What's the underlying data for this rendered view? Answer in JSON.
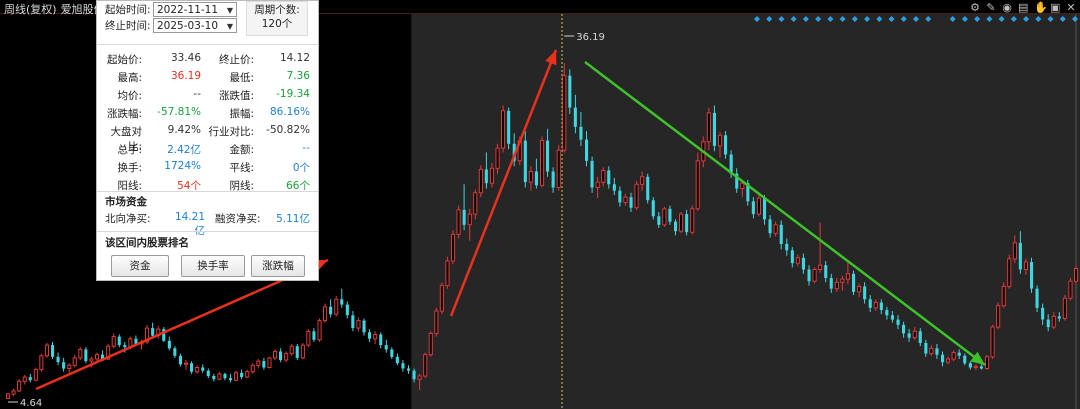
{
  "header": {
    "title_parts": [
      "周线(复权)",
      "爱旭股份"
    ],
    "toolbar_icons": [
      "gear-icon",
      "pen-icon",
      "eye-icon",
      "print-icon",
      "hand-icon",
      "lock-icon",
      "close-icon"
    ]
  },
  "panel": {
    "start_label": "起始时间:",
    "start_date": "2022-11-11",
    "end_label": "终止时间:",
    "end_date": "2025-03-10",
    "count_label": "周期个数:",
    "count_value": "120个",
    "stats": [
      {
        "l1": "起始价:",
        "v1": "33.46",
        "c1": "dark",
        "l2": "终止价:",
        "v2": "14.12",
        "c2": "dark"
      },
      {
        "l1": "最高:",
        "v1": "36.19",
        "c1": "red",
        "l2": "最低:",
        "v2": "7.36",
        "c2": "green"
      },
      {
        "l1": "均价:",
        "v1": "--",
        "c1": "dark",
        "l2": "涨跌值:",
        "v2": "-19.34",
        "c2": "green"
      },
      {
        "l1": "涨跌幅:",
        "v1": "-57.81%",
        "c1": "green",
        "l2": "振幅:",
        "v2": "86.16%",
        "c2": "blue"
      },
      {
        "l1": "大盘对比:",
        "v1": "9.42%",
        "c1": "dark",
        "l2": "行业对比:",
        "v2": "-50.82%",
        "c2": "dark"
      },
      {
        "l1": "总手:",
        "v1": "2.42亿",
        "c1": "blue",
        "l2": "金额:",
        "v2": "--",
        "c2": "blue"
      },
      {
        "l1": "换手:",
        "v1": "1724%",
        "c1": "blue",
        "l2": "平线:",
        "v2": "0个",
        "c2": "blue"
      },
      {
        "l1": "阳线:",
        "v1": "54个",
        "c1": "red",
        "l2": "阴线:",
        "v2": "66个",
        "c2": "green"
      }
    ],
    "fund_title": "市场资金",
    "north_label": "北向净买:",
    "north_value": "14.21亿",
    "margin_label": "融资净买:",
    "margin_value": "5.11亿",
    "rank_title": "该区间内股票排名",
    "buttons": [
      "资金",
      "换手率",
      "涨跌幅"
    ]
  },
  "colors": {
    "up": "#e03a3a",
    "down": "#3ed6e0",
    "red_arrow": "#e8321e",
    "green_arrow": "#3ec22a",
    "selection_bg": "#262626",
    "marker": "#2f9de0"
  },
  "chart_data": {
    "type": "candlestick",
    "periodicity": "weekly",
    "annotations": {
      "high_label": "36.19",
      "low_label": "4.64"
    },
    "high": 36.19,
    "low": 4.64,
    "selection": {
      "start": "2022-11-11",
      "end": "2025-03-10",
      "periods": 120
    },
    "ohlc": [
      [
        4.7,
        5.2,
        4.64,
        5.1
      ],
      [
        5.1,
        5.6,
        4.9,
        5.4
      ],
      [
        5.4,
        6.5,
        5.3,
        6.3
      ],
      [
        6.3,
        6.9,
        6.0,
        6.7
      ],
      [
        6.7,
        7.0,
        6.2,
        6.4
      ],
      [
        6.4,
        7.6,
        6.3,
        7.4
      ],
      [
        7.4,
        8.9,
        7.2,
        8.7
      ],
      [
        8.7,
        9.9,
        8.5,
        9.7
      ],
      [
        9.7,
        10.0,
        8.4,
        8.6
      ],
      [
        8.6,
        9.0,
        7.8,
        8.1
      ],
      [
        8.1,
        8.5,
        7.2,
        7.5
      ],
      [
        7.5,
        8.0,
        7.1,
        7.8
      ],
      [
        7.8,
        8.8,
        7.6,
        8.5
      ],
      [
        8.5,
        9.5,
        8.3,
        9.3
      ],
      [
        9.3,
        9.5,
        8.0,
        8.2
      ],
      [
        8.2,
        8.6,
        7.6,
        8.4
      ],
      [
        8.4,
        9.0,
        8.1,
        8.8
      ],
      [
        8.8,
        9.2,
        8.2,
        8.4
      ],
      [
        8.4,
        9.8,
        8.3,
        9.6
      ],
      [
        9.6,
        10.8,
        9.4,
        10.5
      ],
      [
        10.5,
        10.7,
        9.5,
        9.7
      ],
      [
        9.7,
        10.0,
        9.0,
        9.5
      ],
      [
        9.5,
        10.5,
        9.3,
        10.3
      ],
      [
        10.3,
        10.6,
        9.6,
        9.8
      ],
      [
        9.8,
        10.2,
        9.3,
        10.0
      ],
      [
        10.0,
        11.6,
        9.8,
        11.3
      ],
      [
        11.3,
        11.8,
        10.4,
        10.6
      ],
      [
        10.6,
        11.5,
        10.3,
        11.2
      ],
      [
        11.2,
        11.4,
        10.0,
        10.1
      ],
      [
        10.1,
        10.5,
        9.2,
        9.4
      ],
      [
        9.4,
        9.6,
        8.5,
        8.7
      ],
      [
        8.7,
        8.9,
        7.7,
        7.9
      ],
      [
        7.9,
        8.3,
        7.4,
        8.0
      ],
      [
        8.0,
        8.2,
        7.0,
        7.2
      ],
      [
        7.2,
        7.8,
        7.0,
        7.6
      ],
      [
        7.6,
        7.9,
        7.1,
        7.3
      ],
      [
        7.3,
        7.5,
        6.6,
        6.8
      ],
      [
        6.8,
        7.0,
        6.3,
        6.5
      ],
      [
        6.5,
        7.2,
        6.4,
        7.0
      ],
      [
        7.0,
        7.1,
        6.4,
        6.6
      ],
      [
        6.6,
        7.0,
        6.2,
        6.4
      ],
      [
        6.4,
        7.3,
        6.3,
        7.1
      ],
      [
        7.1,
        7.4,
        6.5,
        6.7
      ],
      [
        6.7,
        7.4,
        6.6,
        7.2
      ],
      [
        7.2,
        8.0,
        7.0,
        7.8
      ],
      [
        7.8,
        8.4,
        7.5,
        8.2
      ],
      [
        8.2,
        8.5,
        7.4,
        7.6
      ],
      [
        7.6,
        8.6,
        7.5,
        8.5
      ],
      [
        8.5,
        9.3,
        8.3,
        9.1
      ],
      [
        9.1,
        9.4,
        8.1,
        8.3
      ],
      [
        8.3,
        9.1,
        8.1,
        8.9
      ],
      [
        8.9,
        9.8,
        8.7,
        9.6
      ],
      [
        9.6,
        9.8,
        8.3,
        8.5
      ],
      [
        8.5,
        9.9,
        8.4,
        9.7
      ],
      [
        9.7,
        11.2,
        9.5,
        11.0
      ],
      [
        11.0,
        11.3,
        10.0,
        10.2
      ],
      [
        10.2,
        12.2,
        10.0,
        12.0
      ],
      [
        12.0,
        13.6,
        11.8,
        13.3
      ],
      [
        13.3,
        14.0,
        12.3,
        12.6
      ],
      [
        12.6,
        14.3,
        12.4,
        14.0
      ],
      [
        14.0,
        15.0,
        13.2,
        13.5
      ],
      [
        13.5,
        13.8,
        12.2,
        12.5
      ],
      [
        12.5,
        12.9,
        11.0,
        11.3
      ],
      [
        11.3,
        12.3,
        11.0,
        12.0
      ],
      [
        12.0,
        12.2,
        10.6,
        10.9
      ],
      [
        10.9,
        11.2,
        10.0,
        10.3
      ],
      [
        10.3,
        11.0,
        9.8,
        10.7
      ],
      [
        10.7,
        10.9,
        9.4,
        9.7
      ],
      [
        9.7,
        10.2,
        9.0,
        9.3
      ],
      [
        9.3,
        9.5,
        8.4,
        8.6
      ],
      [
        8.6,
        8.9,
        7.8,
        8.0
      ],
      [
        8.0,
        8.3,
        7.2,
        7.5
      ],
      [
        7.5,
        7.8,
        7.0,
        7.3
      ],
      [
        7.3,
        7.5,
        6.2,
        6.5
      ],
      [
        6.5,
        7.0,
        5.5,
        6.8
      ],
      [
        6.8,
        9.0,
        6.6,
        8.8
      ],
      [
        8.8,
        11.0,
        8.6,
        10.8
      ],
      [
        10.8,
        13.2,
        10.5,
        12.9
      ],
      [
        12.9,
        15.6,
        12.6,
        15.3
      ],
      [
        15.3,
        18.0,
        15.0,
        17.6
      ],
      [
        17.6,
        20.5,
        17.3,
        20.1
      ],
      [
        20.1,
        22.8,
        19.7,
        22.4
      ],
      [
        22.4,
        24.8,
        20.5,
        21.0
      ],
      [
        21.0,
        22.5,
        19.5,
        22.0
      ],
      [
        22.0,
        24.3,
        21.5,
        24.0
      ],
      [
        24.0,
        26.6,
        23.6,
        26.2
      ],
      [
        26.2,
        27.8,
        24.4,
        24.9
      ],
      [
        24.9,
        26.8,
        24.5,
        26.3
      ],
      [
        26.3,
        28.6,
        25.8,
        28.2
      ],
      [
        28.2,
        32.2,
        27.8,
        31.7
      ],
      [
        31.7,
        32.0,
        28.1,
        28.6
      ],
      [
        28.6,
        29.6,
        26.5,
        27.0
      ],
      [
        27.0,
        29.3,
        26.6,
        28.9
      ],
      [
        28.9,
        29.8,
        24.5,
        25.0
      ],
      [
        25.0,
        26.5,
        24.2,
        26.0
      ],
      [
        26.0,
        27.2,
        24.4,
        24.7
      ],
      [
        24.7,
        29.3,
        24.5,
        28.9
      ],
      [
        28.9,
        30.0,
        25.5,
        26.0
      ],
      [
        26.0,
        26.4,
        24.0,
        24.5
      ],
      [
        24.5,
        28.5,
        24.2,
        28.0
      ],
      [
        28.0,
        36.19,
        27.8,
        35.0
      ],
      [
        35.0,
        35.6,
        31.4,
        32.0
      ],
      [
        32.0,
        33.2,
        29.6,
        30.2
      ],
      [
        30.2,
        31.6,
        28.4,
        29.0
      ],
      [
        29.0,
        29.8,
        26.5,
        27.0
      ],
      [
        27.0,
        27.4,
        24.0,
        24.5
      ],
      [
        24.5,
        25.5,
        23.5,
        25.0
      ],
      [
        25.0,
        26.4,
        24.6,
        26.1
      ],
      [
        26.1,
        26.5,
        24.4,
        24.8
      ],
      [
        24.8,
        25.4,
        23.8,
        24.2
      ],
      [
        24.2,
        24.6,
        22.7,
        23.1
      ],
      [
        23.1,
        23.9,
        22.8,
        23.6
      ],
      [
        23.6,
        24.0,
        22.2,
        22.6
      ],
      [
        22.6,
        25.1,
        22.4,
        24.8
      ],
      [
        24.8,
        26.0,
        24.2,
        25.5
      ],
      [
        25.5,
        25.8,
        23.0,
        23.3
      ],
      [
        23.3,
        23.6,
        21.5,
        21.8
      ],
      [
        21.8,
        22.2,
        20.7,
        21.0
      ],
      [
        21.0,
        22.7,
        20.8,
        22.5
      ],
      [
        22.5,
        22.8,
        21.0,
        21.3
      ],
      [
        21.3,
        21.5,
        20.0,
        20.4
      ],
      [
        20.4,
        22.2,
        20.2,
        22.0
      ],
      [
        22.0,
        22.4,
        20.0,
        20.3
      ],
      [
        20.3,
        22.8,
        20.1,
        22.5
      ],
      [
        22.5,
        27.8,
        22.3,
        27.0
      ],
      [
        27.0,
        29.3,
        26.4,
        28.8
      ],
      [
        28.8,
        32.0,
        28.0,
        31.5
      ],
      [
        31.5,
        32.2,
        27.9,
        28.4
      ],
      [
        28.4,
        29.7,
        27.3,
        29.4
      ],
      [
        29.4,
        29.8,
        27.2,
        27.6
      ],
      [
        27.6,
        28.0,
        25.4,
        25.8
      ],
      [
        25.8,
        26.3,
        24.0,
        24.4
      ],
      [
        24.4,
        25.2,
        23.6,
        24.9
      ],
      [
        24.9,
        25.2,
        22.8,
        23.2
      ],
      [
        23.2,
        23.6,
        21.6,
        22.0
      ],
      [
        22.0,
        23.9,
        21.8,
        23.5
      ],
      [
        23.5,
        23.8,
        21.0,
        21.5
      ],
      [
        21.5,
        21.9,
        19.8,
        20.2
      ],
      [
        20.2,
        21.3,
        19.9,
        21.0
      ],
      [
        21.0,
        21.4,
        18.7,
        19.2
      ],
      [
        19.2,
        19.7,
        18.1,
        18.6
      ],
      [
        18.6,
        18.9,
        17.0,
        17.4
      ],
      [
        17.4,
        18.2,
        17.1,
        17.9
      ],
      [
        17.9,
        18.3,
        16.4,
        16.8
      ],
      [
        16.8,
        17.2,
        15.3,
        15.7
      ],
      [
        15.7,
        17.0,
        15.5,
        16.8
      ],
      [
        16.8,
        21.2,
        16.5,
        17.2
      ],
      [
        17.2,
        17.6,
        15.6,
        16.0
      ],
      [
        16.0,
        16.4,
        14.6,
        15.0
      ],
      [
        15.0,
        16.0,
        14.7,
        15.6
      ],
      [
        15.6,
        16.2,
        14.8,
        15.9
      ],
      [
        15.9,
        17.5,
        15.4,
        16.4
      ],
      [
        16.4,
        16.7,
        14.4,
        14.7
      ],
      [
        14.7,
        15.5,
        14.2,
        15.2
      ],
      [
        15.2,
        15.6,
        13.6,
        14.0
      ],
      [
        14.0,
        14.4,
        12.8,
        13.2
      ],
      [
        13.2,
        14.0,
        12.9,
        13.7
      ],
      [
        13.7,
        14.0,
        12.6,
        13.0
      ],
      [
        13.0,
        13.3,
        12.1,
        12.5
      ],
      [
        12.5,
        12.9,
        11.8,
        12.1
      ],
      [
        12.1,
        12.5,
        11.2,
        11.6
      ],
      [
        11.6,
        11.9,
        10.4,
        10.8
      ],
      [
        10.8,
        11.2,
        10.0,
        10.4
      ],
      [
        10.4,
        11.4,
        10.2,
        11.0
      ],
      [
        11.0,
        11.3,
        9.6,
        9.9
      ],
      [
        9.9,
        10.2,
        8.6,
        8.9
      ],
      [
        8.9,
        9.7,
        8.7,
        9.4
      ],
      [
        9.4,
        9.8,
        8.4,
        8.8
      ],
      [
        8.8,
        9.1,
        7.7,
        8.1
      ],
      [
        8.1,
        8.6,
        7.9,
        8.4
      ],
      [
        8.4,
        9.2,
        8.2,
        9.0
      ],
      [
        9.0,
        9.3,
        8.4,
        8.7
      ],
      [
        8.7,
        8.9,
        7.8,
        8.0
      ],
      [
        8.0,
        8.2,
        7.4,
        7.6
      ],
      [
        7.6,
        7.9,
        7.36,
        7.7
      ],
      [
        7.7,
        7.9,
        7.4,
        7.5
      ],
      [
        7.5,
        8.8,
        7.4,
        8.6
      ],
      [
        8.6,
        11.6,
        8.4,
        11.4
      ],
      [
        11.4,
        13.7,
        11.2,
        13.4
      ],
      [
        13.4,
        15.6,
        13.2,
        15.2
      ],
      [
        15.2,
        18.2,
        15.0,
        17.8
      ],
      [
        17.8,
        20.0,
        17.4,
        19.3
      ],
      [
        19.3,
        20.4,
        16.4,
        16.8
      ],
      [
        16.8,
        17.8,
        16.3,
        17.5
      ],
      [
        17.5,
        17.9,
        14.6,
        15.0
      ],
      [
        15.0,
        15.3,
        12.8,
        13.2
      ],
      [
        13.2,
        13.6,
        11.6,
        12.1
      ],
      [
        12.1,
        12.6,
        11.0,
        11.4
      ],
      [
        11.4,
        12.8,
        11.2,
        12.4
      ],
      [
        12.4,
        12.8,
        11.9,
        12.2
      ],
      [
        12.2,
        14.4,
        12.0,
        14.1
      ],
      [
        14.1,
        16.0,
        13.9,
        15.7
      ],
      [
        15.7,
        17.2,
        15.4,
        16.9
      ]
    ]
  }
}
